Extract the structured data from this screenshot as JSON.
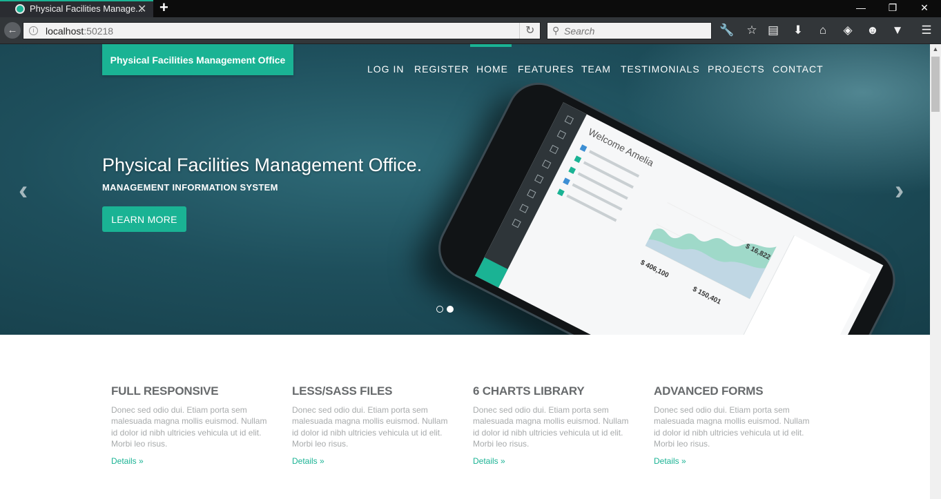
{
  "browser": {
    "tab_title": "Physical Facilities Manage...",
    "tab_close": "✕",
    "new_tab": "+",
    "url_host": "localhost",
    "url_port": ":50218",
    "search_placeholder": "Search",
    "toolbar_icons": [
      "wrench-icon",
      "star-icon",
      "reading-list-icon",
      "download-icon",
      "home-icon",
      "extension-icon",
      "emoji-icon",
      "pocket-icon",
      "menu-icon"
    ]
  },
  "site": {
    "brand": "Physical Facilities Management Office",
    "menu": [
      "LOG IN",
      "REGISTER",
      "HOME",
      "FEATURES",
      "TEAM",
      "TESTIMONIALS",
      "PROJECTS",
      "CONTACT"
    ],
    "active_menu": "HOME",
    "accent_color": "#1ab394"
  },
  "hero": {
    "title": "Physical Facilities Management Office.",
    "subtitle": "MANAGEMENT INFORMATION SYSTEM",
    "button": "LEARN MORE",
    "slides": 2,
    "active_slide": 2
  },
  "phone_screen": {
    "welcome": "Welcome Amelia",
    "stat_1": "$ 406,100",
    "stat_2": "$ 150,401",
    "stat_3": "$ 16,822"
  },
  "features": [
    {
      "title": "FULL RESPONSIVE",
      "text": "Donec sed odio dui. Etiam porta sem malesuada magna mollis euismod. Nullam id dolor id nibh ultricies vehicula ut id elit. Morbi leo risus.",
      "link": "Details »"
    },
    {
      "title": "LESS/SASS FILES",
      "text": "Donec sed odio dui. Etiam porta sem malesuada magna mollis euismod. Nullam id dolor id nibh ultricies vehicula ut id elit. Morbi leo risus.",
      "link": "Details »"
    },
    {
      "title": "6 CHARTS LIBRARY",
      "text": "Donec sed odio dui. Etiam porta sem malesuada magna mollis euismod. Nullam id dolor id nibh ultricies vehicula ut id elit. Morbi leo risus.",
      "link": "Details »"
    },
    {
      "title": "ADVANCED FORMS",
      "text": "Donec sed odio dui. Etiam porta sem malesuada magna mollis euismod. Nullam id dolor id nibh ultricies vehicula ut id elit. Morbi leo risus.",
      "link": "Details »"
    }
  ]
}
